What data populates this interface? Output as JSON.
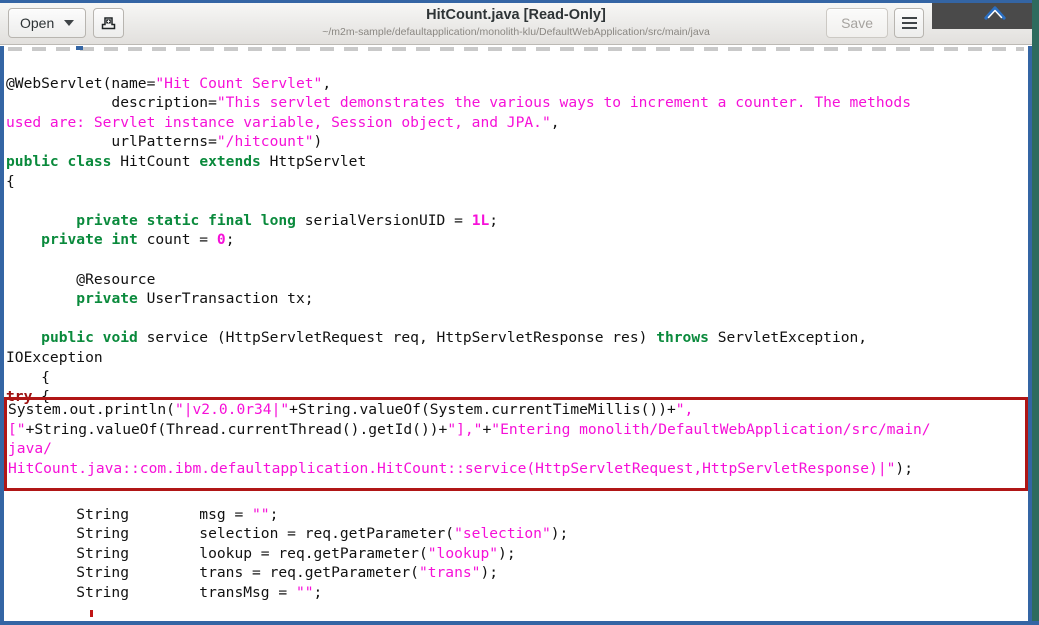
{
  "window": {
    "title": "HitCount.java [Read-Only]",
    "subtitle": "~/m2m-sample/defaultapplication/monolith-klu/DefaultWebApplication/src/main/java",
    "open_button": "Open",
    "save_button": "Save",
    "icons": {
      "open_dropdown": "chevron-down-icon",
      "new_document": "save-document-icon",
      "menu": "hamburger-menu-icon",
      "minimize": "minimize-icon",
      "maximize": "maximize-icon",
      "close": "close-icon",
      "overlay_chevron": "chevron-up-icon"
    }
  },
  "colors": {
    "accent_blue": "#3465a4",
    "keyword_green": "#0a8a3c",
    "keyword_red": "#9b1010",
    "string_magenta": "#f610d8",
    "highlight_border_red": "#b01616",
    "edge_green": "#2e6b5e",
    "overlay_grey": "#4a4a4a"
  },
  "code": {
    "language": "java",
    "lines": [
      [],
      [
        {
          "t": "@WebServlet(name=",
          "c": "plain"
        },
        {
          "t": "\"Hit Count Servlet\"",
          "c": "str"
        },
        {
          "t": ",",
          "c": "plain"
        }
      ],
      [
        {
          "t": "            description=",
          "c": "plain"
        },
        {
          "t": "\"This servlet demonstrates the various ways to increment a counter. The methods",
          "c": "str"
        }
      ],
      [
        {
          "t": "used are: Servlet instance variable, Session object, and JPA.\"",
          "c": "str"
        },
        {
          "t": ",",
          "c": "plain"
        }
      ],
      [
        {
          "t": "            urlPatterns=",
          "c": "plain"
        },
        {
          "t": "\"/hitcount\"",
          "c": "str"
        },
        {
          "t": ")",
          "c": "plain"
        }
      ],
      [
        {
          "t": "public class ",
          "c": "kw"
        },
        {
          "t": "HitCount ",
          "c": "plain"
        },
        {
          "t": "extends ",
          "c": "kw"
        },
        {
          "t": "HttpServlet",
          "c": "plain"
        }
      ],
      [
        {
          "t": "{",
          "c": "plain"
        }
      ],
      [],
      [
        {
          "t": "        ",
          "c": "plain"
        },
        {
          "t": "private static final long ",
          "c": "kw"
        },
        {
          "t": "serialVersionUID = ",
          "c": "plain"
        },
        {
          "t": "1L",
          "c": "num"
        },
        {
          "t": ";",
          "c": "plain"
        }
      ],
      [
        {
          "t": "    ",
          "c": "plain"
        },
        {
          "t": "private int ",
          "c": "kw"
        },
        {
          "t": "count = ",
          "c": "plain"
        },
        {
          "t": "0",
          "c": "num"
        },
        {
          "t": ";",
          "c": "plain"
        }
      ],
      [],
      [
        {
          "t": "        @Resource",
          "c": "plain"
        }
      ],
      [
        {
          "t": "        ",
          "c": "plain"
        },
        {
          "t": "private ",
          "c": "kw"
        },
        {
          "t": "UserTransaction tx;",
          "c": "plain"
        }
      ],
      [],
      [
        {
          "t": "    ",
          "c": "plain"
        },
        {
          "t": "public void ",
          "c": "kw"
        },
        {
          "t": "service (HttpServletRequest req, HttpServletResponse res) ",
          "c": "plain"
        },
        {
          "t": "throws ",
          "c": "kw"
        },
        {
          "t": "ServletException,",
          "c": "plain"
        }
      ],
      [
        {
          "t": "IOException",
          "c": "plain"
        }
      ],
      [
        {
          "t": "    {",
          "c": "plain"
        }
      ],
      [
        {
          "t": "try ",
          "c": "kw2"
        },
        {
          "t": "{",
          "c": "plain"
        }
      ],
      [],
      [],
      [],
      [],
      [],
      [
        {
          "t": "        String        msg = ",
          "c": "plain"
        },
        {
          "t": "\"\"",
          "c": "str"
        },
        {
          "t": ";",
          "c": "plain"
        }
      ],
      [
        {
          "t": "        String        selection = req.getParameter(",
          "c": "plain"
        },
        {
          "t": "\"selection\"",
          "c": "str"
        },
        {
          "t": ");",
          "c": "plain"
        }
      ],
      [
        {
          "t": "        String        lookup = req.getParameter(",
          "c": "plain"
        },
        {
          "t": "\"lookup\"",
          "c": "str"
        },
        {
          "t": ");",
          "c": "plain"
        }
      ],
      [
        {
          "t": "        String        trans = req.getParameter(",
          "c": "plain"
        },
        {
          "t": "\"trans\"",
          "c": "str"
        },
        {
          "t": ");",
          "c": "plain"
        }
      ],
      [
        {
          "t": "        String        transMsg = ",
          "c": "plain"
        },
        {
          "t": "\"\"",
          "c": "str"
        },
        {
          "t": ";",
          "c": "plain"
        }
      ]
    ],
    "highlighted_block": {
      "description": "instrumentation println statement outlined in red",
      "lines": [
        [
          {
            "t": "System.out.println(",
            "c": "plain"
          },
          {
            "t": "\"|v2.0.0r34|\"",
            "c": "str"
          },
          {
            "t": "+String.valueOf(System.currentTimeMillis())+",
            "c": "plain"
          },
          {
            "t": "\",",
            "c": "str"
          }
        ],
        [
          {
            "t": "[\"",
            "c": "str"
          },
          {
            "t": "+String.valueOf(Thread.currentThread().getId())+",
            "c": "plain"
          },
          {
            "t": "\"],\"",
            "c": "str"
          },
          {
            "t": "+",
            "c": "plain"
          },
          {
            "t": "\"Entering monolith/DefaultWebApplication/src/main/",
            "c": "str"
          }
        ],
        [
          {
            "t": "java/",
            "c": "str"
          }
        ],
        [
          {
            "t": "HitCount.java::com.ibm.defaultapplication.HitCount::service(HttpServletRequest,HttpServletResponse)|\"",
            "c": "str"
          },
          {
            "t": ");",
            "c": "plain"
          }
        ]
      ]
    }
  }
}
